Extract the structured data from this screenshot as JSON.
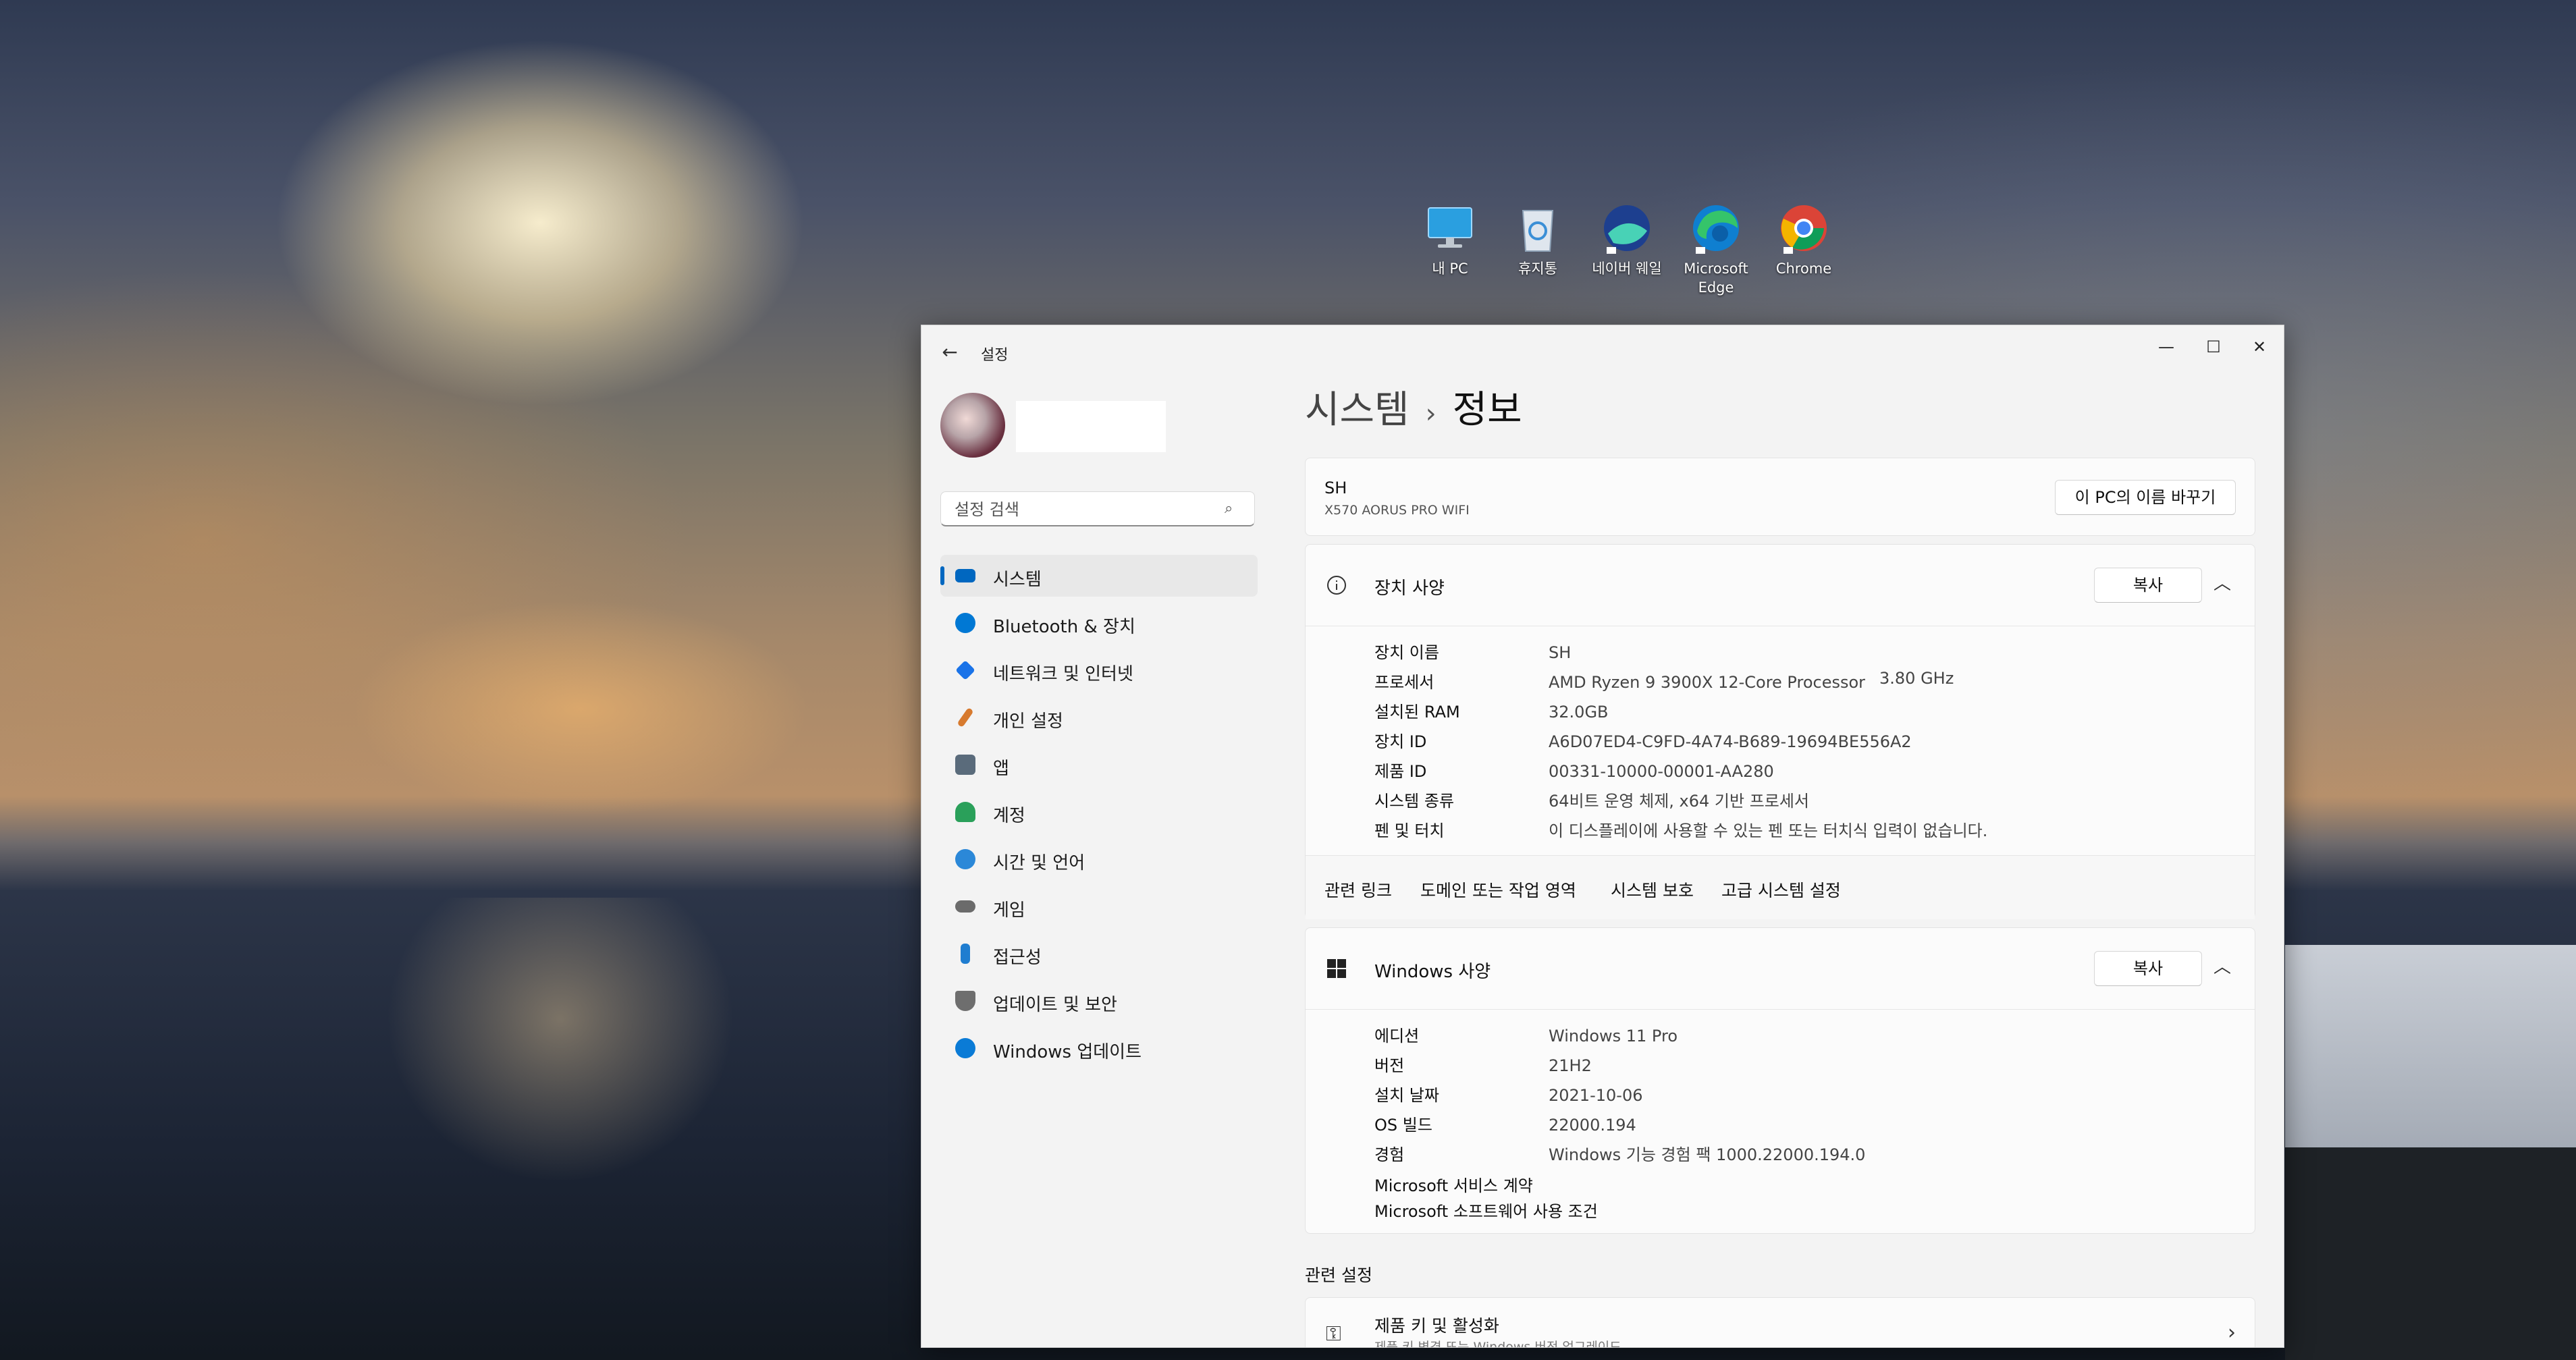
{
  "desktop": {
    "icons": [
      {
        "label": "내 PC",
        "icon": "monitor-icon"
      },
      {
        "label": "휴지통",
        "icon": "recycle-bin-icon"
      },
      {
        "label": "네이버 웨일",
        "icon": "whale-browser-icon"
      },
      {
        "label": "Microsoft Edge",
        "icon": "edge-icon"
      },
      {
        "label": "Chrome",
        "icon": "chrome-icon"
      }
    ]
  },
  "window": {
    "title": "설정",
    "controls": {
      "minimize": "—",
      "maximize": "☐",
      "close": "✕"
    },
    "back_glyph": "←"
  },
  "sidebar": {
    "search_placeholder": "설정 검색",
    "items": [
      {
        "label": "시스템",
        "icon": "system-icon",
        "color": "#0067c0",
        "active": true
      },
      {
        "label": "Bluetooth & 장치",
        "icon": "bluetooth-icon",
        "color": "#0078d4"
      },
      {
        "label": "네트워크 및 인터넷",
        "icon": "network-icon",
        "color": "#1a73e8"
      },
      {
        "label": "개인 설정",
        "icon": "brush-icon",
        "color": "#d77a2e"
      },
      {
        "label": "앱",
        "icon": "apps-icon",
        "color": "#5a6b7b"
      },
      {
        "label": "계정",
        "icon": "account-icon",
        "color": "#2aa05a"
      },
      {
        "label": "시간 및 언어",
        "icon": "globe-icon",
        "color": "#2b88d8"
      },
      {
        "label": "게임",
        "icon": "gamepad-icon",
        "color": "#6b6b6b"
      },
      {
        "label": "접근성",
        "icon": "accessibility-icon",
        "color": "#1f7dd0"
      },
      {
        "label": "업데이트 및 보안",
        "icon": "shield-icon",
        "color": "#6e6e6e"
      },
      {
        "label": "Windows 업데이트",
        "icon": "windows-update-icon",
        "color": "#0a7bd6"
      }
    ]
  },
  "content": {
    "breadcrumb_parent": "시스템",
    "breadcrumb_sep": "›",
    "breadcrumb_current": "정보",
    "pc_name": "SH",
    "pc_model": "X570 AORUS PRO WIFI",
    "rename_button": "이 PC의 이름 바꾸기",
    "device_specs": {
      "title": "장치 사양",
      "copy_button": "복사",
      "rows": [
        {
          "key": "장치 이름",
          "value": "SH"
        },
        {
          "key": "프로세서",
          "value": "AMD Ryzen 9 3900X 12-Core Processor"
        },
        {
          "key": "설치된 RAM",
          "value": "32.0GB"
        },
        {
          "key": "장치 ID",
          "value": "A6D07ED4-C9FD-4A74-B689-19694BE556A2"
        },
        {
          "key": "제품 ID",
          "value": "00331-10000-00001-AA280"
        },
        {
          "key": "시스템 종류",
          "value": "64비트 운영 체제, x64 기반 프로세서"
        },
        {
          "key": "펜 및 터치",
          "value": "이 디스플레이에 사용할 수 있는 펜 또는 터치식 입력이 없습니다."
        }
      ],
      "processor_speed": "3.80 GHz"
    },
    "related_links": [
      "관련 링크",
      "도메인 또는 작업 영역",
      "시스템 보호",
      "고급 시스템 설정"
    ],
    "windows_specs": {
      "title": "Windows 사양",
      "copy_button": "복사",
      "rows": [
        {
          "key": "에디션",
          "value": "Windows 11 Pro"
        },
        {
          "key": "버전",
          "value": "21H2"
        },
        {
          "key": "설치 날짜",
          "value": "2021-10-06"
        },
        {
          "key": "OS 빌드",
          "value": "22000.194"
        },
        {
          "key": "경험",
          "value": "Windows 기능 경험 팩 1000.22000.194.0"
        }
      ],
      "links": [
        "Microsoft 서비스 계약",
        "Microsoft 소프트웨어 사용 조건"
      ]
    },
    "related_settings_title": "관련 설정",
    "product_key": {
      "title": "제품 키 및 활성화",
      "subtitle": "제품 키 변경 또는 Windows 버전 업그레이드"
    }
  }
}
